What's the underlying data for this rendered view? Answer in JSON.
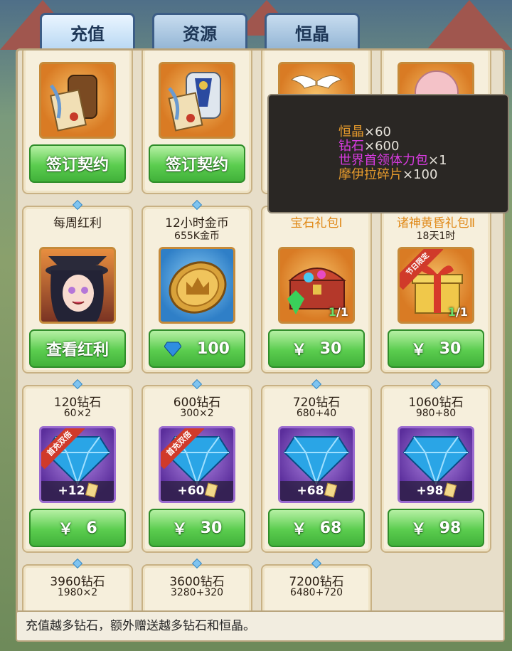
{
  "tabs": [
    {
      "label": "充值",
      "active": true
    },
    {
      "label": "资源",
      "active": false
    },
    {
      "label": "恒晶",
      "active": false
    }
  ],
  "row1": [
    {
      "button": "签订契约",
      "icon": "armor-contract-icon"
    },
    {
      "button": "签订契约",
      "icon": "silver-armor-contract-icon"
    },
    {
      "icon": "wings-icon"
    },
    {
      "icon": "pink-hair-character-icon"
    }
  ],
  "tooltip": {
    "items": [
      {
        "name": "恒晶",
        "qty": "×60",
        "color": "#e59a2c"
      },
      {
        "name": "钻石",
        "qty": "×600",
        "color": "#d83be0"
      },
      {
        "name": "世界首领体力包",
        "qty": "×1",
        "color": "#d83be0"
      },
      {
        "name": "摩伊拉碎片",
        "qty": "×100",
        "color": "#e59a2c"
      }
    ]
  },
  "row2": [
    {
      "title": "每周红利",
      "button": "查看红利",
      "icon": "portrait-girl-icon"
    },
    {
      "title": "12小时金币",
      "sub": "655K金币",
      "price": "100",
      "icon": "gold-coin-icon"
    },
    {
      "title": "宝石礼包Ⅰ",
      "price": "30",
      "currency": "￥",
      "count": "1",
      "limit": "/1",
      "icon": "treasure-chest-icon"
    },
    {
      "title": "诸神黄昏礼包Ⅱ",
      "sub": "18天1时",
      "price": "30",
      "currency": "￥",
      "count": "1",
      "limit": "/1",
      "badge": "节日限定",
      "icon": "gift-box-icon"
    }
  ],
  "row3": [
    {
      "title": "120钻石",
      "sub": "60×2",
      "bonus": "+12",
      "ribbon": "首充双倍",
      "price": "6",
      "currency": "￥"
    },
    {
      "title": "600钻石",
      "sub": "300×2",
      "bonus": "+60",
      "ribbon": "首充双倍",
      "price": "30",
      "currency": "￥"
    },
    {
      "title": "720钻石",
      "sub": "680+40",
      "bonus": "+68",
      "price": "68",
      "currency": "￥"
    },
    {
      "title": "1060钻石",
      "sub": "980+80",
      "bonus": "+98",
      "price": "98",
      "currency": "￥"
    }
  ],
  "row4": [
    {
      "title": "3960钻石",
      "sub": "1980×2"
    },
    {
      "title": "3600钻石",
      "sub": "3280+320"
    },
    {
      "title": "7200钻石",
      "sub": "6480+720"
    }
  ],
  "footer": {
    "text": "充值越多钻石，额外赠送越多钻石和恒晶。"
  }
}
